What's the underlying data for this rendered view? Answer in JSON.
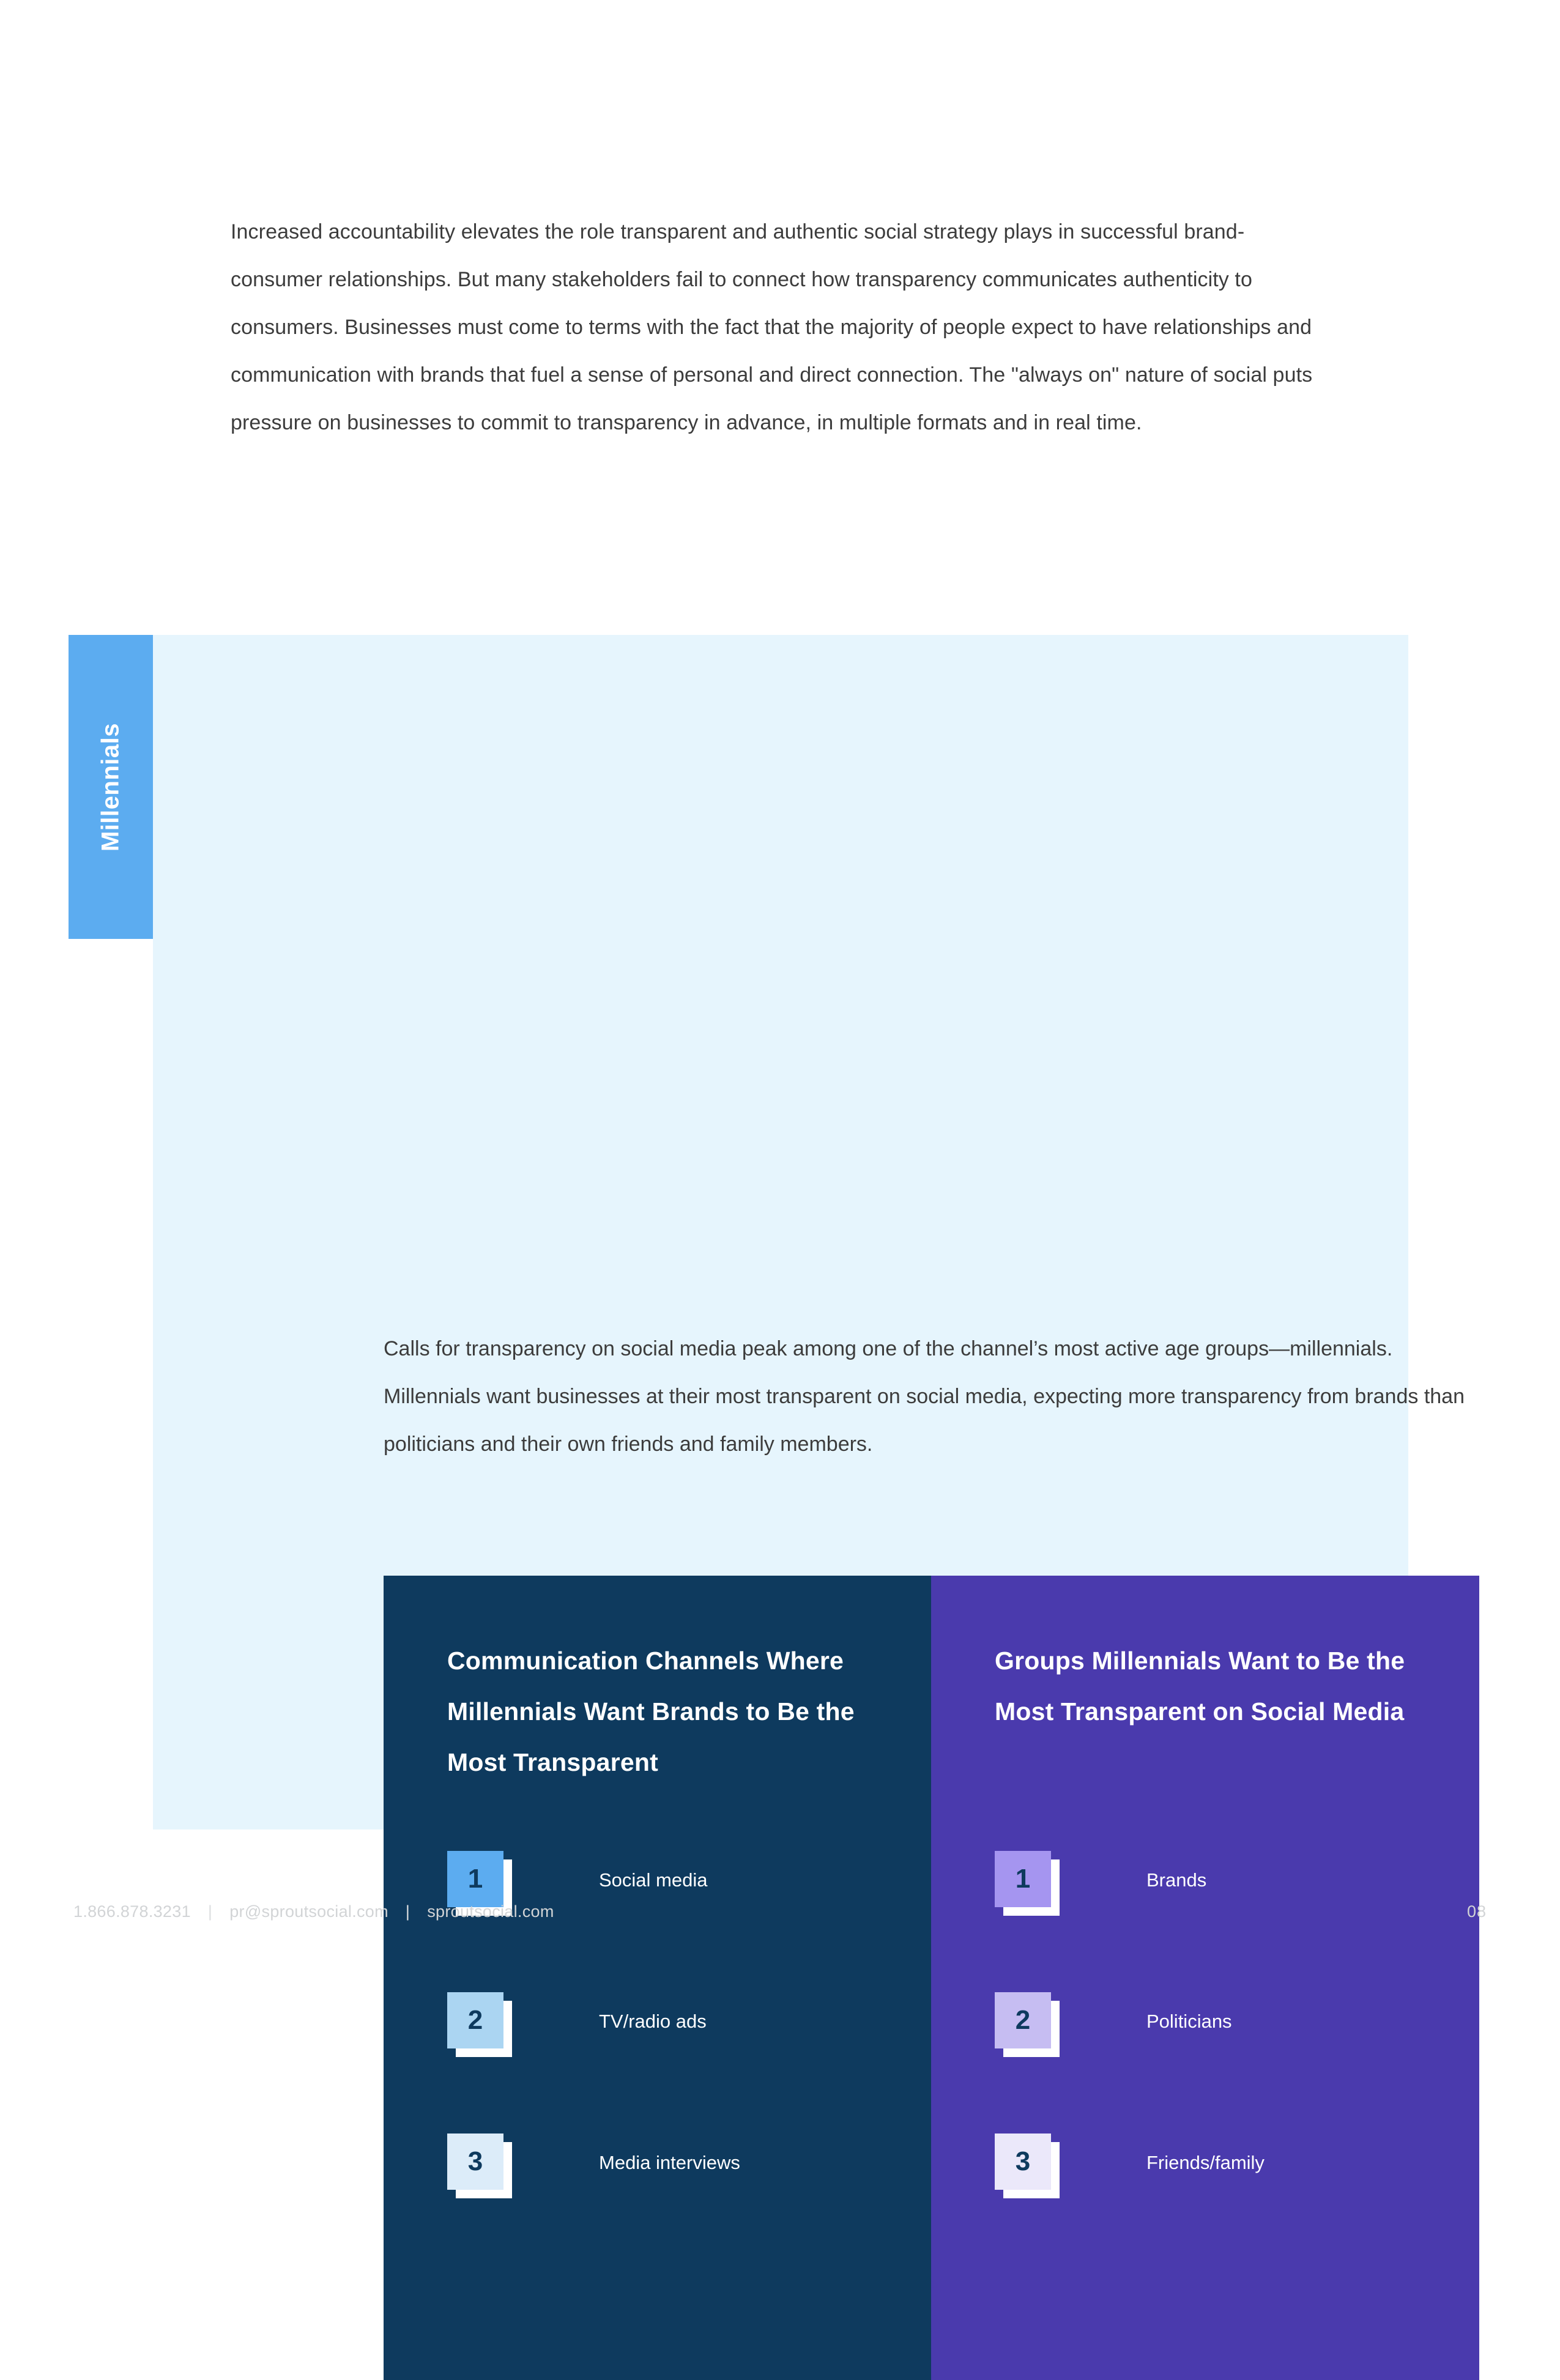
{
  "intro": {
    "paragraph": "Increased accountability elevates the role transparent and authentic social strategy plays in successful brand-consumer relationships. But many stakeholders fail to connect how transparency communicates authenticity to consumers. Businesses must come to terms with the fact that the majority of people expect to have relationships and communication with brands that fuel a sense of personal and direct connection. The \"always on\" nature of social puts pressure on businesses to commit to transparency in advance, in multiple formats and in real time."
  },
  "millennials_section": {
    "tab_label": "Millennials",
    "tab_color": "#5cacf0",
    "band_color": "#e6f5fd",
    "paragraph": "Calls for transparency on social media peak among one of the channel’s most active age groups—millennials. Millennials want businesses at their most transparent on social media, expecting more transparency from brands than politicians and their own friends and family members."
  },
  "data_panel": {
    "left": {
      "background_color": "#0e3a5e",
      "heading": "Communication Channels Where Millennials Want Brands to Be the Most Transparent",
      "items": [
        {
          "rank": "1",
          "label": "Social media",
          "card_color": "#5cacf0"
        },
        {
          "rank": "2",
          "label": "TV/radio ads",
          "card_color": "#abd5f2"
        },
        {
          "rank": "3",
          "label": "Media interviews",
          "card_color": "#dcecf9"
        }
      ]
    },
    "right": {
      "background_color": "#4a3aad",
      "heading": "Groups Millennials Want to Be the Most Transparent on Social Media",
      "items": [
        {
          "rank": "1",
          "label": "Brands",
          "card_color": "#a595f0"
        },
        {
          "rank": "2",
          "label": "Politicians",
          "card_color": "#c6bdf2"
        },
        {
          "rank": "3",
          "label": "Friends/family",
          "card_color": "#ebe8fa"
        }
      ]
    }
  },
  "footer": {
    "phone": "1.866.878.3231",
    "separator": "|",
    "email": "pr@sproutsocial.com",
    "website": "sproutsocial.com",
    "page_number": "08"
  }
}
